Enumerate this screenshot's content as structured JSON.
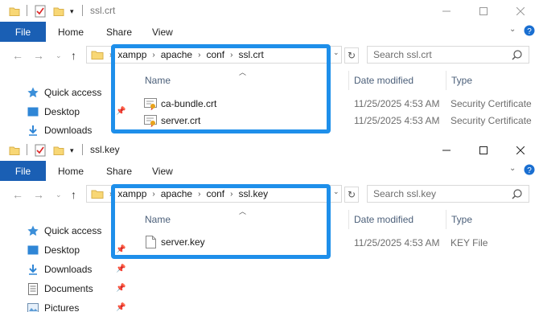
{
  "colors": {
    "file_tab": "#1a5fb4",
    "highlight": "#1e8fea",
    "header_text": "#4c607a"
  },
  "windows": [
    {
      "title": "ssl.crt",
      "ribbon": {
        "file": "File",
        "tabs": [
          "Home",
          "Share",
          "View"
        ]
      },
      "breadcrumbs": [
        "xampp",
        "apache",
        "conf",
        "ssl.crt"
      ],
      "search_placeholder": "Search ssl.crt",
      "nav": [
        {
          "label": "Quick access",
          "icon": "star-icon"
        },
        {
          "label": "Desktop",
          "icon": "desktop-icon"
        },
        {
          "label": "Downloads",
          "icon": "download-icon"
        }
      ],
      "columns": {
        "name": "Name",
        "date": "Date modified",
        "type": "Type"
      },
      "files": [
        {
          "name": "ca-bundle.crt",
          "date": "11/25/2025 4:53 AM",
          "type": "Security Certificate",
          "icon": "certificate-icon"
        },
        {
          "name": "server.crt",
          "date": "11/25/2025 4:53 AM",
          "type": "Security Certificate",
          "icon": "certificate-icon"
        }
      ]
    },
    {
      "title": "ssl.key",
      "ribbon": {
        "file": "File",
        "tabs": [
          "Home",
          "Share",
          "View"
        ]
      },
      "breadcrumbs": [
        "xampp",
        "apache",
        "conf",
        "ssl.key"
      ],
      "search_placeholder": "Search ssl.key",
      "nav": [
        {
          "label": "Quick access",
          "icon": "star-icon"
        },
        {
          "label": "Desktop",
          "icon": "desktop-icon"
        },
        {
          "label": "Downloads",
          "icon": "download-icon"
        },
        {
          "label": "Documents",
          "icon": "documents-icon"
        },
        {
          "label": "Pictures",
          "icon": "pictures-icon"
        }
      ],
      "columns": {
        "name": "Name",
        "date": "Date modified",
        "type": "Type"
      },
      "files": [
        {
          "name": "server.key",
          "date": "11/25/2025 4:53 AM",
          "type": "KEY File",
          "icon": "file-icon"
        }
      ]
    }
  ]
}
